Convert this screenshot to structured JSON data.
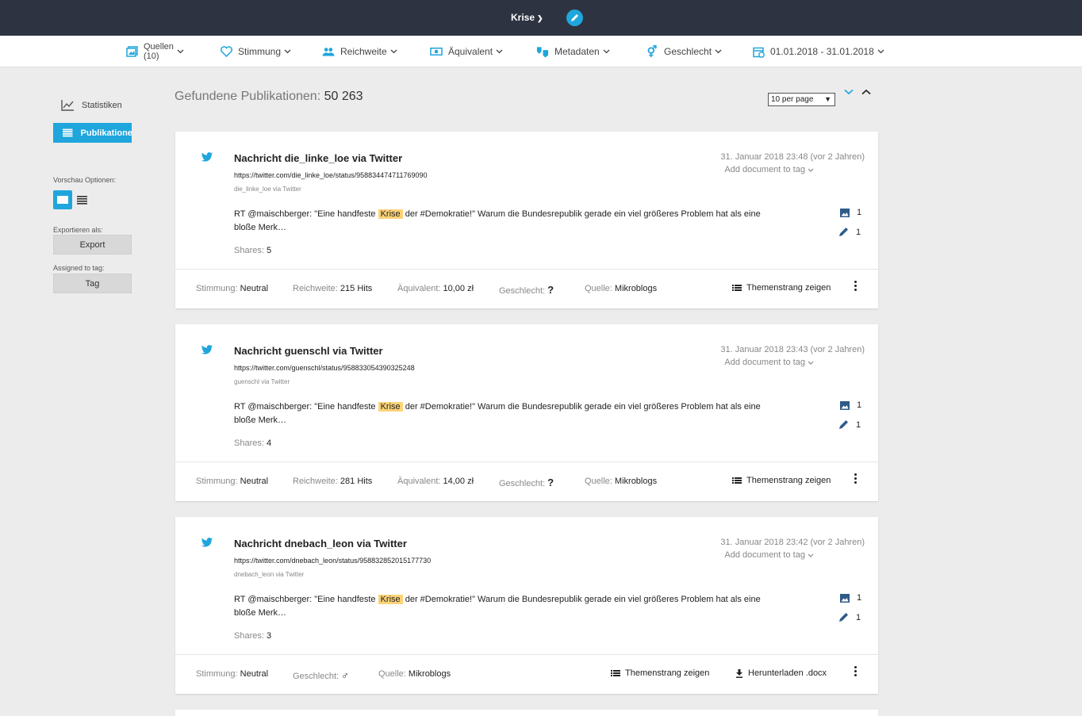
{
  "topbar": {
    "title": "Krise"
  },
  "filters": [
    {
      "label": "Quellen",
      "sub": "(10)"
    },
    {
      "label": "Stimmung"
    },
    {
      "label": "Reichweite"
    },
    {
      "label": "Äquivalent"
    },
    {
      "label": "Metadaten"
    },
    {
      "label": "Geschlecht"
    },
    {
      "label": "01.01.2018 - 31.01.2018"
    }
  ],
  "sidebar": {
    "statistiken": "Statistiken",
    "publikationen": "Publikationen",
    "vorschau_label": "Vorschau Optionen:",
    "export_label": "Exportieren als:",
    "export_button": "Export",
    "tag_label": "Assigned to tag:",
    "tag_button": "Tag"
  },
  "main": {
    "found_label": "Gefundene Publikationen:",
    "found_count": "50 263",
    "per_page": "10 per page"
  },
  "labels": {
    "stimmung": "Stimmung:",
    "reichweite": "Reichweite:",
    "aequivalent": "Äquivalent:",
    "geschlecht": "Geschlecht:",
    "quelle": "Quelle:",
    "shares": "Shares:",
    "themenstrang": "Themenstrang zeigen",
    "herunterladen": "Herunterladen .docx",
    "add_tag": "Add document to tag"
  },
  "cards": [
    {
      "title": "Nachricht die_linke_loe via Twitter",
      "url": "https://twitter.com/die_linke_loe/status/958834474711769090",
      "via": "die_linke_loe via Twitter",
      "date": "31. Januar 2018 23:48 (vor 2 Jahren)",
      "text_before": "RT @maischberger: \"Eine handfeste ",
      "highlight": "Krise",
      "text_after": " der #Demokratie!\" Warum die Bundesrepublik gerade ein viel größeres Problem hat als eine bloße Merk…",
      "shares": "5",
      "images": "1",
      "edits": "1",
      "stimmung": "Neutral",
      "reichweite": "215 Hits",
      "aequivalent": "10,00 zł",
      "geschlecht": "?",
      "quelle": "Mikroblogs"
    },
    {
      "title": "Nachricht guenschl via Twitter",
      "url": "https://twitter.com/guenschl/status/958833054390325248",
      "via": "guenschl via Twitter",
      "date": "31. Januar 2018 23:43 (vor 2 Jahren)",
      "text_before": "RT @maischberger: \"Eine handfeste ",
      "highlight": "Krise",
      "text_after": " der #Demokratie!\" Warum die Bundesrepublik gerade ein viel größeres Problem hat als eine bloße Merk…",
      "shares": "4",
      "images": "1",
      "edits": "1",
      "stimmung": "Neutral",
      "reichweite": "281 Hits",
      "aequivalent": "14,00 zł",
      "geschlecht": "?",
      "quelle": "Mikroblogs"
    },
    {
      "title": "Nachricht dnebach_leon via Twitter",
      "url": "https://twitter.com/dnebach_leon/status/958832852015177730",
      "via": "dnebach_leon via Twitter",
      "date": "31. Januar 2018 23:42 (vor 2 Jahren)",
      "text_before": "RT @maischberger: \"Eine handfeste ",
      "highlight": "Krise",
      "text_after": " der #Demokratie!\" Warum die Bundesrepublik gerade ein viel größeres Problem hat als eine bloße Merk…",
      "shares": "3",
      "images": "1",
      "edits": "1",
      "stimmung": "Neutral",
      "geschlecht": "♂",
      "quelle": "Mikroblogs"
    }
  ],
  "colors": {
    "accent": "#1fa6dc",
    "topbar": "#2d3341",
    "highlight": "#fcd378"
  }
}
